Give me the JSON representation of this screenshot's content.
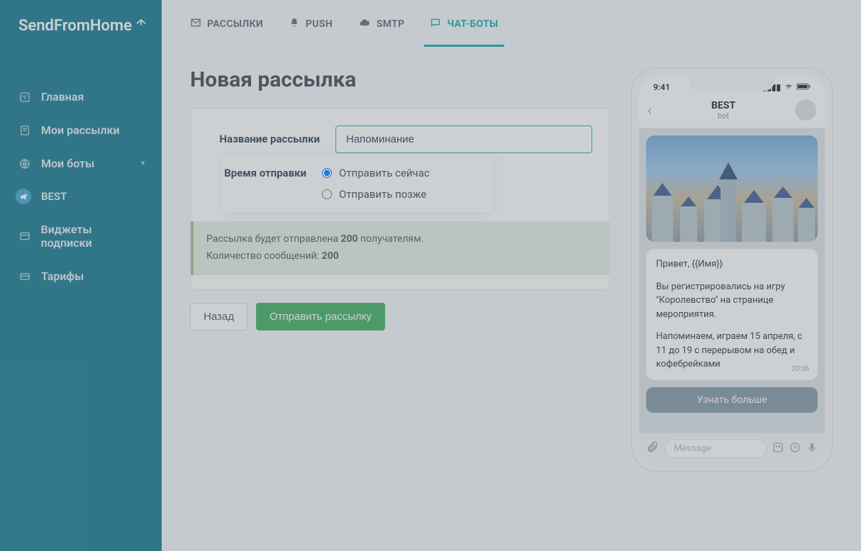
{
  "brand": "SendFromHome",
  "sidebar": {
    "items": [
      {
        "label": "Главная",
        "icon": "home"
      },
      {
        "label": "Мои рассылки",
        "icon": "campaigns"
      },
      {
        "label": "Мои боты",
        "icon": "globe",
        "expandable": true
      },
      {
        "label": "Виджеты подписки",
        "icon": "widget"
      },
      {
        "label": "Тарифы",
        "icon": "card"
      }
    ],
    "bot_sub": "BEST"
  },
  "tabs": [
    {
      "label": "РАССЫЛКИ",
      "icon": "mail"
    },
    {
      "label": "PUSH",
      "icon": "bell"
    },
    {
      "label": "SMTP",
      "icon": "cloud"
    },
    {
      "label": "ЧАТ-БОТЫ",
      "icon": "chat",
      "active": true
    }
  ],
  "page_title": "Новая рассылка",
  "form": {
    "name_label": "Название рассылки",
    "name_value": "Напоминание",
    "time_label": "Время отправки",
    "send_now": "Отправить сейчас",
    "send_later": "Отправить позже"
  },
  "notice": {
    "line1_a": "Рассылка будет отправлена ",
    "recipients": "200",
    "line1_b": " получателям.",
    "line2_a": "Количество сообщений: ",
    "messages": "200"
  },
  "actions": {
    "back": "Назад",
    "send": "Отправить рассылку"
  },
  "phone": {
    "time": "9:41",
    "chat_name": "BEST",
    "chat_sub": "bot",
    "msg": {
      "p1": "Привет, {{Имя}}",
      "p2": "Вы регистрировались на игру \"Королевство\" на странице мероприятия.",
      "p3": "Напоминаем, играем 15 апреля, с 11 до 19 с перерывом на обед и кофебрейками",
      "time": "20:06"
    },
    "button": "Узнать больше",
    "input_placeholder": "Message"
  }
}
